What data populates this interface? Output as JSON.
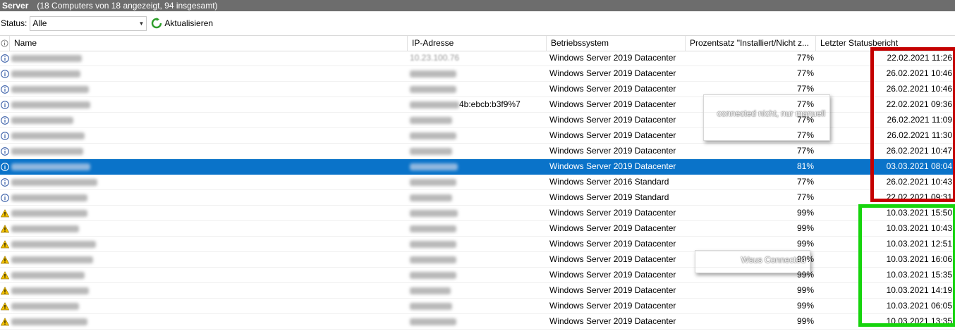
{
  "window": {
    "title": "Server",
    "subtitle": "(18 Computers von 18 angezeigt, 94 insgesamt)"
  },
  "toolbar": {
    "status_label": "Status:",
    "status_value": "Alle",
    "refresh_label": "Aktualisieren"
  },
  "columns": [
    "Name",
    "IP-Adresse",
    "Betriebssystem",
    "Prozentsatz \"Installiert/Nicht z...",
    "Letzter Statusbericht"
  ],
  "rows": [
    {
      "icon": "info-icon",
      "ip": "10.23.100.76",
      "ip_clear": true,
      "os": "Windows Server 2019 Datacenter",
      "pct": "77%",
      "date": "22.02.2021 11:26",
      "selected": false
    },
    {
      "icon": "info-icon",
      "ip": "",
      "ip_clear": false,
      "os": "Windows Server 2019 Datacenter",
      "pct": "77%",
      "date": "26.02.2021 10:46",
      "selected": false
    },
    {
      "icon": "info-icon",
      "ip": "",
      "ip_clear": false,
      "os": "Windows Server 2019 Datacenter",
      "pct": "77%",
      "date": "26.02.2021 10:46",
      "selected": false
    },
    {
      "icon": "info-icon",
      "ip": "4b:ebcb:b3f9%7",
      "ip_clear": false,
      "os": "Windows Server 2019 Datacenter",
      "pct": "77%",
      "date": "22.02.2021 09:36",
      "selected": false
    },
    {
      "icon": "info-icon",
      "ip": "",
      "ip_clear": false,
      "os": "Windows Server 2019 Datacenter",
      "pct": "77%",
      "date": "26.02.2021 11:09",
      "selected": false
    },
    {
      "icon": "info-icon",
      "ip": "",
      "ip_clear": false,
      "os": "Windows Server 2019 Datacenter",
      "pct": "77%",
      "date": "26.02.2021 11:30",
      "selected": false
    },
    {
      "icon": "info-icon",
      "ip": "",
      "ip_clear": false,
      "os": "Windows Server 2019 Datacenter",
      "pct": "77%",
      "date": "26.02.2021 10:47",
      "selected": false
    },
    {
      "icon": "info-icon",
      "ip": "",
      "ip_clear": false,
      "os": "Windows Server 2019 Datacenter",
      "pct": "81%",
      "date": "03.03.2021 08:04",
      "selected": true
    },
    {
      "icon": "info-icon",
      "ip": "",
      "ip_clear": false,
      "os": "Windows Server 2016 Standard",
      "pct": "77%",
      "date": "26.02.2021 10:43",
      "selected": false
    },
    {
      "icon": "info-icon",
      "ip": "",
      "ip_clear": false,
      "os": "Windows Server 2019 Standard",
      "pct": "77%",
      "date": "22.02.2021 09:31",
      "selected": false
    },
    {
      "icon": "warning-icon",
      "ip": "",
      "ip_clear": false,
      "os": "Windows Server 2019 Datacenter",
      "pct": "99%",
      "date": "10.03.2021 15:50",
      "selected": false
    },
    {
      "icon": "warning-icon",
      "ip": "",
      "ip_clear": false,
      "os": "Windows Server 2019 Datacenter",
      "pct": "99%",
      "date": "10.03.2021 10:43",
      "selected": false
    },
    {
      "icon": "warning-icon",
      "ip": "",
      "ip_clear": false,
      "os": "Windows Server 2019 Datacenter",
      "pct": "99%",
      "date": "10.03.2021 12:51",
      "selected": false
    },
    {
      "icon": "warning-icon",
      "ip": "",
      "ip_clear": false,
      "os": "Windows Server 2019 Datacenter",
      "pct": "99%",
      "date": "10.03.2021 16:06",
      "selected": false
    },
    {
      "icon": "warning-icon",
      "ip": "",
      "ip_clear": false,
      "os": "Windows Server 2019 Datacenter",
      "pct": "99%",
      "date": "10.03.2021 15:35",
      "selected": false
    },
    {
      "icon": "warning-icon",
      "ip": "",
      "ip_clear": false,
      "os": "Windows Server 2019 Datacenter",
      "pct": "99%",
      "date": "10.03.2021 14:19",
      "selected": false
    },
    {
      "icon": "warning-icon",
      "ip": "",
      "ip_clear": false,
      "os": "Windows Server 2019 Datacenter",
      "pct": "99%",
      "date": "10.03.2021 06:05",
      "selected": false
    },
    {
      "icon": "warning-icon",
      "ip": "",
      "ip_clear": false,
      "os": "Windows Server 2019 Datacenter",
      "pct": "99%",
      "date": "10.03.2021 13:35",
      "selected": false
    }
  ],
  "annotations": {
    "red_note": "connected nicht, nur manuell",
    "green_note": "Wsus Connected"
  },
  "colors": {
    "selection": "#0a73c9",
    "red_frame": "#c40000",
    "green_frame": "#16d40c",
    "titlebar": "#6d6d6d"
  }
}
